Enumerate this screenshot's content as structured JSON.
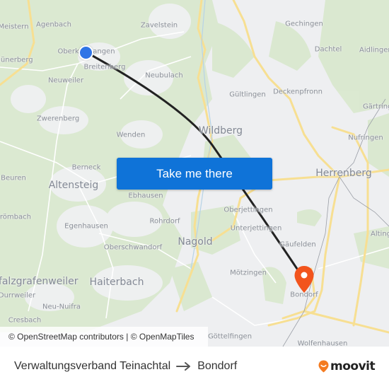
{
  "map": {
    "places": [
      {
        "name": "Meistern",
        "kind": "village"
      },
      {
        "name": "Agenbach",
        "kind": "village"
      },
      {
        "name": "Zavelstein",
        "kind": "village"
      },
      {
        "name": "Gechingen",
        "kind": "village"
      },
      {
        "name": "Dachtel",
        "kind": "village"
      },
      {
        "name": "Aidlingen",
        "kind": "village"
      },
      {
        "name": "Oberkollwangen",
        "kind": "village"
      },
      {
        "name": "Hünerberg",
        "kind": "village"
      },
      {
        "name": "Breitenberg",
        "kind": "village"
      },
      {
        "name": "Neuweiler",
        "kind": "village"
      },
      {
        "name": "Neubulach",
        "kind": "village"
      },
      {
        "name": "Gültlingen",
        "kind": "village"
      },
      {
        "name": "Deckenpfronn",
        "kind": "village"
      },
      {
        "name": "Gärtringen",
        "kind": "village"
      },
      {
        "name": "Zwerenberg",
        "kind": "village"
      },
      {
        "name": "Wildberg",
        "kind": "town"
      },
      {
        "name": "Nufringen",
        "kind": "village"
      },
      {
        "name": "Wenden",
        "kind": "village"
      },
      {
        "name": "Berneck",
        "kind": "village"
      },
      {
        "name": "Beuren",
        "kind": "village"
      },
      {
        "name": "Altensteig",
        "kind": "town"
      },
      {
        "name": "Herrenberg",
        "kind": "town"
      },
      {
        "name": "Ebhausen",
        "kind": "village"
      },
      {
        "name": "Grömbach",
        "kind": "village"
      },
      {
        "name": "Oberjettingen",
        "kind": "village"
      },
      {
        "name": "Egenhausen",
        "kind": "village"
      },
      {
        "name": "Rohrdorf",
        "kind": "village"
      },
      {
        "name": "Unterjettingen",
        "kind": "village"
      },
      {
        "name": "Altingen",
        "kind": "village"
      },
      {
        "name": "Nagold",
        "kind": "town"
      },
      {
        "name": "Gäufelden",
        "kind": "village"
      },
      {
        "name": "Oberschwandorf",
        "kind": "village"
      },
      {
        "name": "Mötzingen",
        "kind": "village"
      },
      {
        "name": "Pfalzgrafenweiler",
        "kind": "town"
      },
      {
        "name": "Haiterbach",
        "kind": "town"
      },
      {
        "name": "Bondorf",
        "kind": "village"
      },
      {
        "name": "Durrweiler",
        "kind": "village"
      },
      {
        "name": "Neu-Nuifra",
        "kind": "village"
      },
      {
        "name": "Cresbach",
        "kind": "village"
      },
      {
        "name": "Göttelfingen",
        "kind": "village"
      },
      {
        "name": "Wolfenhausen",
        "kind": "village"
      }
    ],
    "origin_marker": {
      "icon": "origin-dot-icon",
      "color": "#2f74e6",
      "label": "Verwaltungsverband Teinachtal"
    },
    "destination_marker": {
      "icon": "map-pin-icon",
      "color": "#f2541d",
      "label": "Bondorf"
    },
    "route_line_color": "#222222",
    "attribution": "© OpenStreetMap contributors | © OpenMapTiles"
  },
  "cta": {
    "label": "Take me there",
    "color": "#0f73d8"
  },
  "footer": {
    "origin": "Verwaltungsverband Teinachtal",
    "arrow_icon": "arrow-right-icon",
    "destination": "Bondorf",
    "brand": {
      "name": "moovit",
      "icon": "moovit-pin-icon",
      "accent": "#f47b20"
    }
  }
}
